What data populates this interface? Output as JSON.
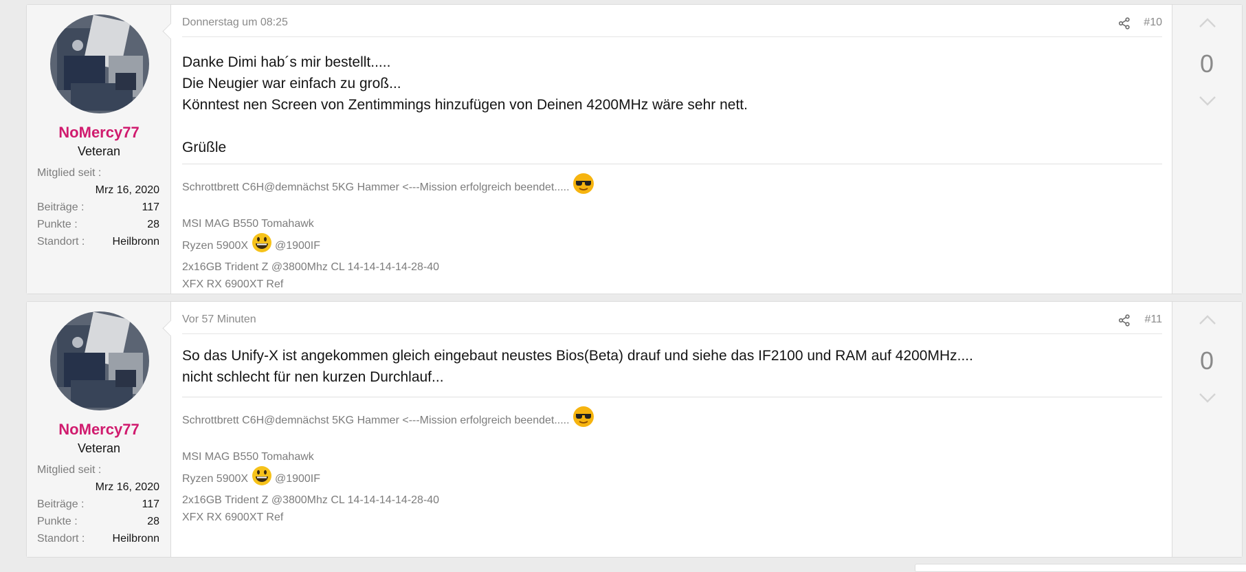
{
  "posts": [
    {
      "user": {
        "name": "NoMercy77",
        "title": "Veteran",
        "member_since_label": "Mitglied seit :",
        "member_since": "Mrz 16, 2020",
        "posts_label": "Beiträge :",
        "posts": "117",
        "points_label": "Punkte :",
        "points": "28",
        "location_label": "Standort :",
        "location": "Heilbronn"
      },
      "date": "Donnerstag um 08:25",
      "number": "#10",
      "body": [
        "Danke Dimi hab´s mir bestellt.....",
        "Die Neugier war einfach zu groß...",
        "Könntest nen Screen von Zentimmings hinzufügen von Deinen 4200MHz wäre sehr nett.",
        "",
        "Grüßle"
      ],
      "signature": {
        "line1": "Schrottbrett C6H@demnächst 5KG Hammer <---Mission erfolgreich beendet.....",
        "line2": "MSI MAG B550 Tomahawk",
        "line3_pre": "Ryzen 5900X",
        "line3_post": "@1900IF",
        "line4": "2x16GB Trident Z @3800Mhz CL 14-14-14-14-28-40",
        "line5": "XFX RX 6900XT Ref"
      },
      "votes": "0",
      "icons": {
        "share": "share-icon",
        "up": "vote-up-icon",
        "down": "vote-down-icon"
      }
    },
    {
      "user": {
        "name": "NoMercy77",
        "title": "Veteran",
        "member_since_label": "Mitglied seit :",
        "member_since": "Mrz 16, 2020",
        "posts_label": "Beiträge :",
        "posts": "117",
        "points_label": "Punkte :",
        "points": "28",
        "location_label": "Standort :",
        "location": "Heilbronn"
      },
      "date": "Vor 57 Minuten",
      "number": "#11",
      "body": [
        "So das Unify-X ist angekommen gleich eingebaut neustes Bios(Beta) drauf und siehe das IF2100 und RAM auf 4200MHz....",
        "nicht schlecht für nen kurzen Durchlauf..."
      ],
      "signature": {
        "line1": "Schrottbrett C6H@demnächst 5KG Hammer <---Mission erfolgreich beendet.....",
        "line2": "MSI MAG B550 Tomahawk",
        "line3_pre": "Ryzen 5900X",
        "line3_post": "@1900IF",
        "line4": "2x16GB Trident Z @3800Mhz CL 14-14-14-14-28-40",
        "line5": "XFX RX 6900XT Ref"
      },
      "votes": "0",
      "icons": {
        "share": "share-icon",
        "up": "vote-up-icon",
        "down": "vote-down-icon"
      }
    }
  ],
  "colors": {
    "username": "#d01b6e",
    "meta": "#8a8a8a",
    "background": "#ebebeb"
  }
}
